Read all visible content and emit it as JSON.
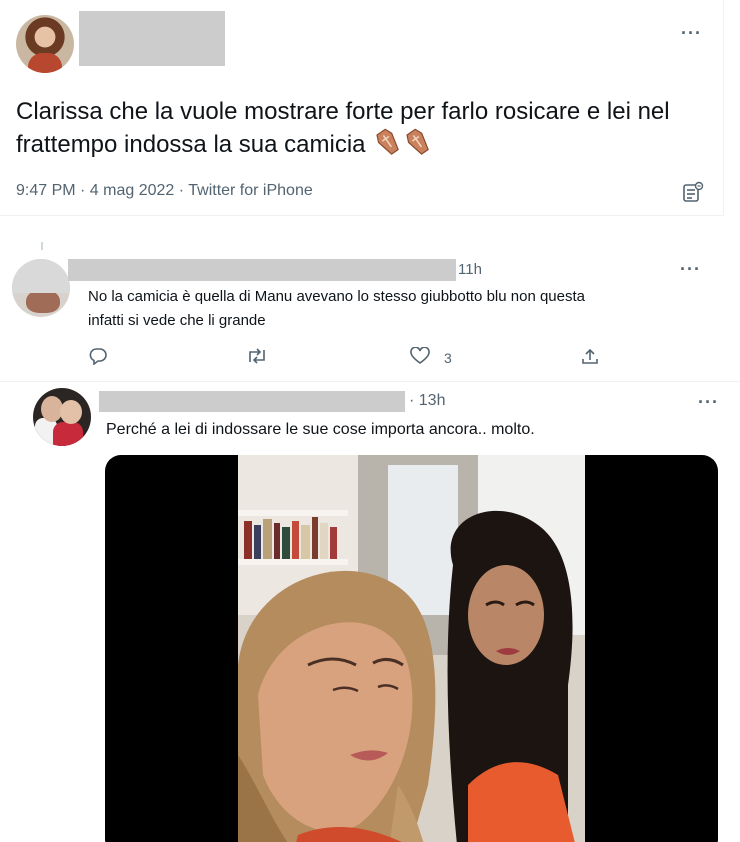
{
  "main_tweet": {
    "text": "Clarissa che la vuole mostrare forte per farlo rosicare e lei nel frattempo indossa la sua camicia",
    "emoji": [
      "coffin-emoji",
      "coffin-emoji"
    ],
    "meta": "9:47 PM · 4 mag 2022 · Twitter for iPhone",
    "more_label": "···",
    "icons": [
      "analytics-icon"
    ]
  },
  "reply1": {
    "time": "11h",
    "more_label": "···",
    "line1": "No la camicia è quella di Manu avevano lo stesso giubbotto blu non questa",
    "line2": "infatti si vede che li grande",
    "like_count": "3",
    "icons": [
      "reply-icon",
      "retweet-icon",
      "like-icon",
      "share-icon"
    ]
  },
  "reply2": {
    "time": "· 13h",
    "more_label": "···",
    "text": "Perché a lei di indossare le sue cose importa ancora.. molto."
  },
  "colors": {
    "text": "#0f1419",
    "secondary": "#536471",
    "divider": "#eff3f4",
    "redaction": "#cccccc"
  }
}
